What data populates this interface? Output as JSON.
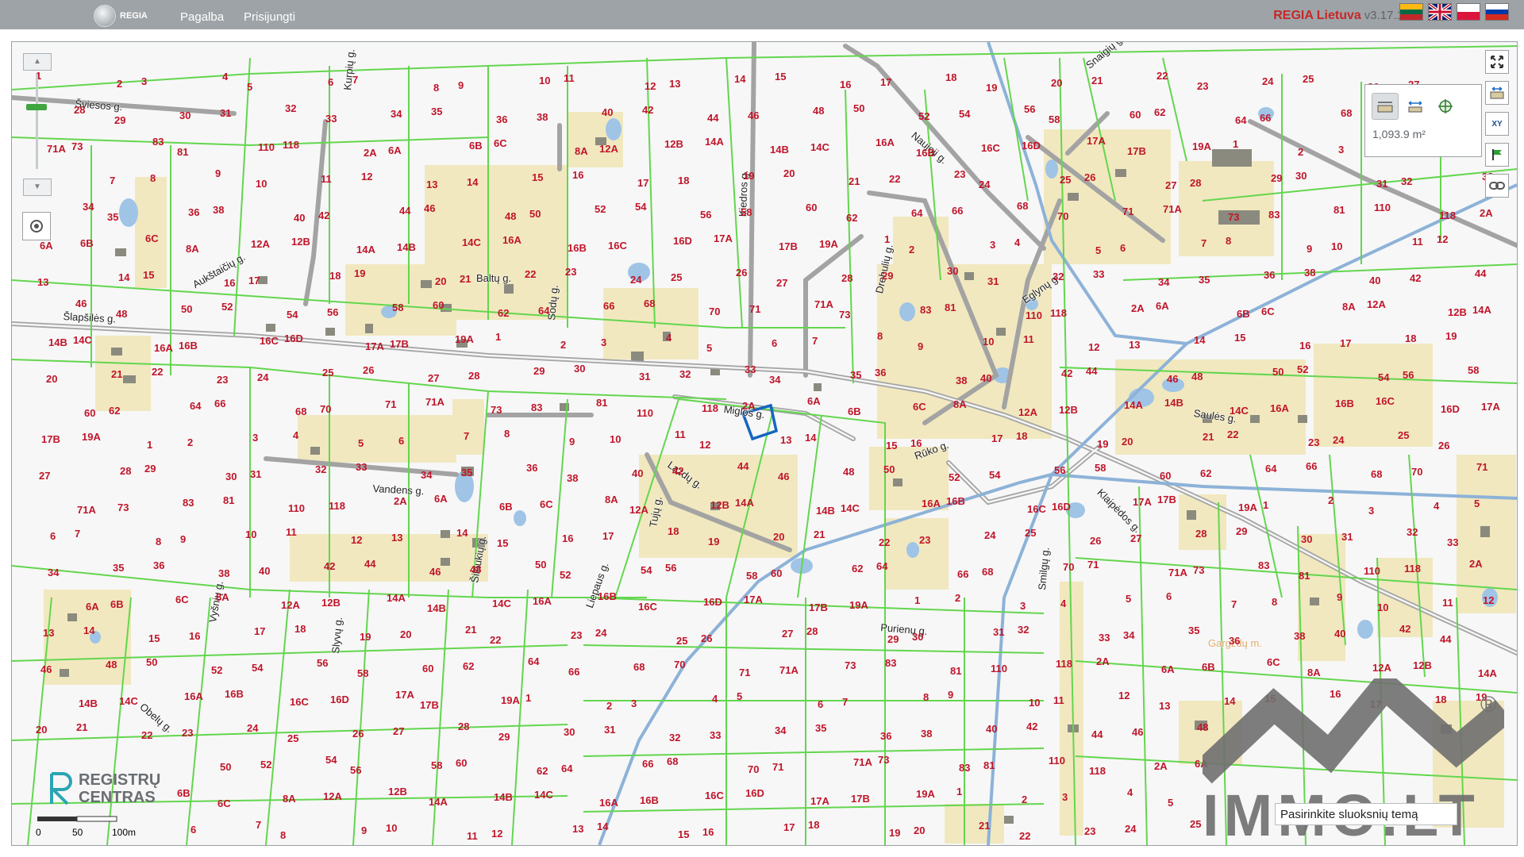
{
  "header": {
    "logo_text": "REGIA",
    "nav": [
      {
        "label": "Pagalba"
      },
      {
        "label": "Prisijungti"
      }
    ],
    "brand": "REGIA Lietuva",
    "version": "v3.17.1",
    "flags": [
      "lt",
      "en",
      "pl",
      "ru"
    ]
  },
  "map": {
    "streets": [
      "Šviesos g.",
      "Kurpių g.",
      "Aukštaičių g.",
      "Baltų g.",
      "Šlapšilės g.",
      "Sodų g.",
      "Kiedros g.",
      "Naujoji g.",
      "Drebulių g.",
      "Eglynų g.",
      "Miglos g.",
      "Lazdų g.",
      "Rūko g.",
      "Tujų g.",
      "Vandens g.",
      "Klaipėdos g.",
      "Saulės g.",
      "Smilgų g.",
      "Purienų g.",
      "Šilaukių g.",
      "Liepaus g.",
      "Vyšnių g.",
      "Slyvų g.",
      "Obelų g.",
      "Snaigių g.",
      "Gargždų m."
    ],
    "parcel_numbers": [
      "1",
      "2",
      "3",
      "4",
      "5",
      "6",
      "7",
      "8",
      "9",
      "10",
      "11",
      "12",
      "13",
      "14",
      "15",
      "16",
      "17",
      "18",
      "19",
      "20",
      "21",
      "22",
      "23",
      "24",
      "25",
      "26",
      "27",
      "28",
      "29",
      "30",
      "31",
      "32",
      "33",
      "34",
      "35",
      "36",
      "38",
      "40",
      "42",
      "44",
      "46",
      "48",
      "50",
      "52",
      "54",
      "56",
      "58",
      "60",
      "62",
      "64",
      "66",
      "68",
      "70",
      "71",
      "71A",
      "73",
      "83",
      "81",
      "110",
      "118",
      "2A",
      "6A",
      "6B",
      "6C",
      "8A",
      "12A",
      "12B",
      "14A",
      "14B",
      "14C",
      "16A",
      "16B",
      "16C",
      "16D",
      "17A",
      "17B",
      "19A"
    ]
  },
  "controls": {
    "zoom_in": "▲",
    "zoom_out": "▼",
    "locate_icon": "target-icon",
    "tools": [
      "fullscreen-icon",
      "extent-icon",
      "xy-icon",
      "flag-icon",
      "link-icon"
    ],
    "tool_xy": "XY"
  },
  "measure": {
    "value": "1,093.9 m²",
    "active_tool": "area"
  },
  "registru": {
    "line1": "REGISTRŲ",
    "line2": "CENTRAS"
  },
  "scale": {
    "labels": [
      "0",
      "50",
      "100m"
    ]
  },
  "watermark": {
    "text": "IMMO.LT",
    "mark": "®"
  },
  "theme_select": {
    "placeholder": "Pasirinkite sluoksnių temą"
  },
  "colors": {
    "parcel_border": "#63d64e",
    "road": "#a3a3a3",
    "building_fill": "#f1e8bf",
    "label": "#c0152a",
    "water": "#9fc4e6",
    "selected": "#1565c0",
    "canal": "#8db2d8"
  }
}
